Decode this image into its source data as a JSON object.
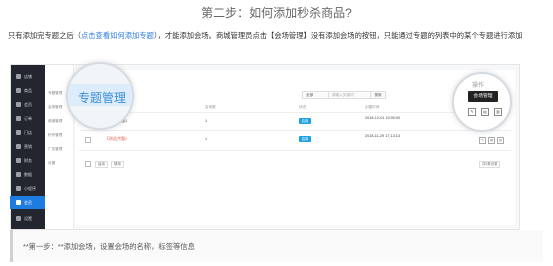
{
  "title": "第二步：如何添加秒杀商品?",
  "intro": {
    "pre": "只有添加完专题之后（",
    "link": "点击查看如何添加专题",
    "post": "），才能添加会场。商城管理员点击【会场管理】没有添加会场的按钮，只能通过专题的列表中的某个专题进行添加"
  },
  "sidebar": {
    "items": [
      {
        "label": "店铺"
      },
      {
        "label": "商品"
      },
      {
        "label": "会员"
      },
      {
        "label": "订单"
      },
      {
        "label": "门店"
      },
      {
        "label": "营销"
      },
      {
        "label": "财务"
      },
      {
        "label": "数据"
      },
      {
        "label": "小程序"
      },
      {
        "label": "会员"
      },
      {
        "label": "设置"
      }
    ],
    "active_index": 9
  },
  "subnav": {
    "items": [
      "专题管理",
      "会场管理",
      "频道管理",
      "秒杀管理",
      "广告管理",
      "设置"
    ]
  },
  "main": {
    "breadcrumb": "营销中心",
    "select_label": "全部",
    "search_placeholder": "请输入关键词",
    "search_button": "搜索",
    "columns": [
      "专题名称",
      "会场数",
      "",
      "状态",
      "创建时间",
      "操作"
    ],
    "rows": [
      {
        "name": "【测试]专题1",
        "count": "1",
        "status": "启用",
        "time": "2018-12-01 10:00:00"
      },
      {
        "name": "【测试]专题2",
        "count": "1",
        "status": "启用",
        "time": "2018-11-29 17:13:13"
      }
    ],
    "footer_buttons": [
      "启用",
      "禁用"
    ],
    "pagination": "共2条记录"
  },
  "magnifier_left": {
    "text": "专题管理"
  },
  "magnifier_right": {
    "header": "操作",
    "tooltip": "会场管理",
    "icons": [
      "edit-icon",
      "venue-icon",
      "delete-icon"
    ]
  },
  "step": {
    "text": "**第一步：**添加会场，设置会场的名称，标签等信息"
  }
}
